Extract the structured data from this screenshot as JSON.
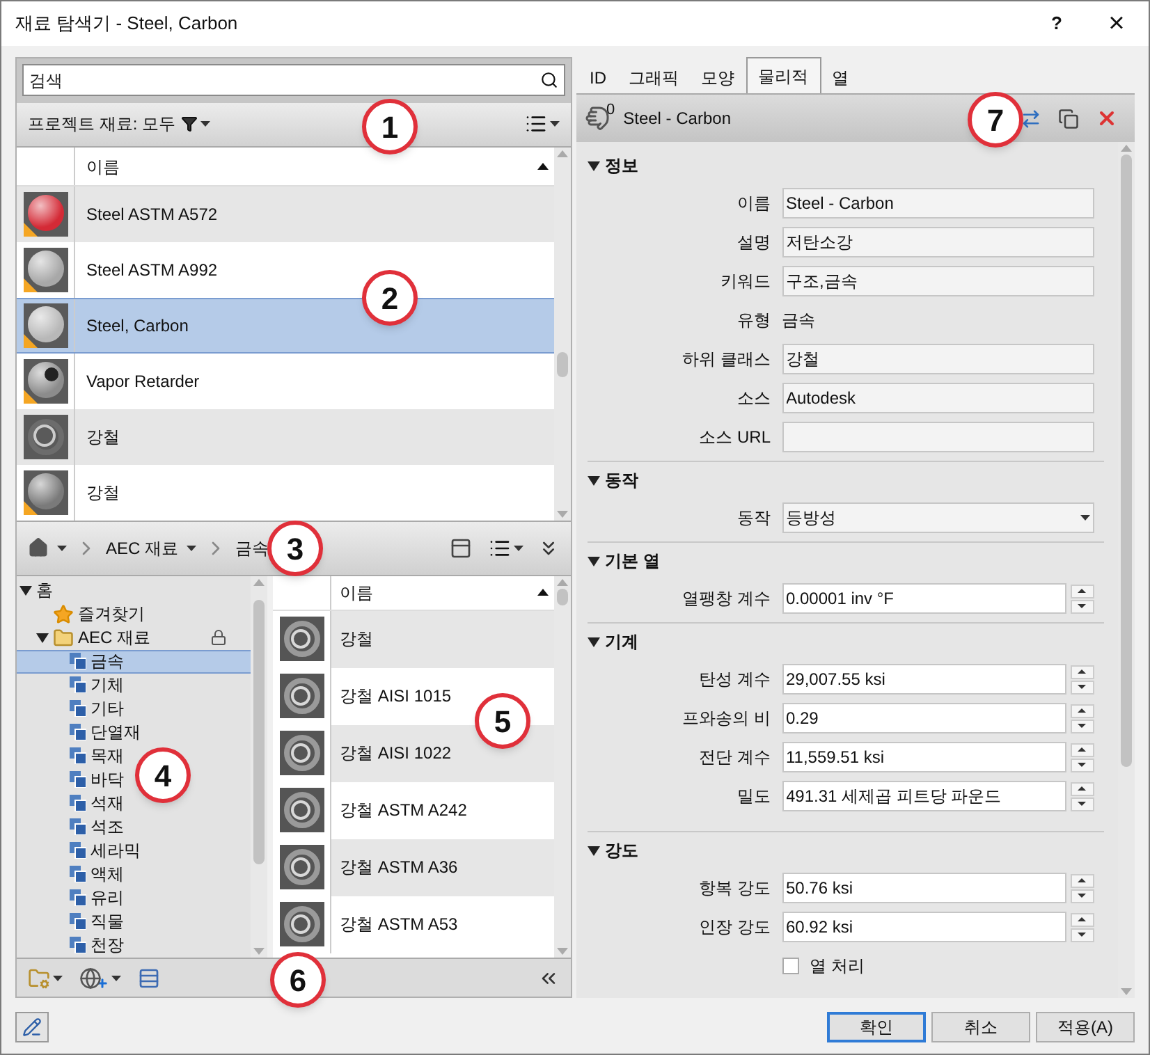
{
  "window": {
    "title": "재료 탐색기 - Steel, Carbon",
    "help": "?",
    "close": "×"
  },
  "project_panel": {
    "search": {
      "placeholder": "검색"
    },
    "filter_label": "프로젝트 재료: 모두",
    "column_header": "이름",
    "rows": [
      {
        "name": "Steel ASTM A572",
        "kind": "sphere",
        "color": "#d42a36",
        "warning": true,
        "selected": false
      },
      {
        "name": "Steel ASTM A992",
        "kind": "sphere",
        "color": "#a8a8a8",
        "warning": true,
        "selected": false
      },
      {
        "name": "Steel, Carbon",
        "kind": "sphere",
        "color": "#b8b8b8",
        "warning": true,
        "selected": true
      },
      {
        "name": "Vapor Retarder",
        "kind": "perforated",
        "color": "#8c8c8c",
        "warning": true,
        "selected": false
      },
      {
        "name": "강철",
        "kind": "ring",
        "color": "#6c6c6c",
        "warning": false,
        "selected": false
      },
      {
        "name": "강철",
        "kind": "sphere",
        "color": "#7a7a7a",
        "warning": true,
        "selected": false
      }
    ]
  },
  "library": {
    "breadcrumb": [
      {
        "label": "AEC 재료"
      },
      {
        "label": "금속"
      }
    ],
    "tree": [
      {
        "label": "홈",
        "expanded": true,
        "selected": false,
        "children": [
          {
            "label": "즐겨찾기",
            "kind": "favorites",
            "selected": false
          },
          {
            "label": "AEC 재료",
            "kind": "folder",
            "expanded": true,
            "locked": true,
            "selected": false,
            "children": [
              {
                "label": "금속",
                "kind": "category",
                "selected": true
              },
              {
                "label": "기체",
                "kind": "category",
                "selected": false
              },
              {
                "label": "기타",
                "kind": "category",
                "selected": false
              },
              {
                "label": "단열재",
                "kind": "category",
                "selected": false
              },
              {
                "label": "목재",
                "kind": "category",
                "selected": false
              },
              {
                "label": "바닥",
                "kind": "category",
                "selected": false
              },
              {
                "label": "석재",
                "kind": "category",
                "selected": false
              },
              {
                "label": "석조",
                "kind": "category",
                "selected": false
              },
              {
                "label": "세라믹",
                "kind": "category",
                "selected": false
              },
              {
                "label": "액체",
                "kind": "category",
                "selected": false
              },
              {
                "label": "유리",
                "kind": "category",
                "selected": false
              },
              {
                "label": "직물",
                "kind": "category",
                "selected": false
              },
              {
                "label": "천장",
                "kind": "category",
                "selected": false
              }
            ]
          }
        ]
      }
    ],
    "column_header": "이름",
    "items": [
      {
        "name": "강철"
      },
      {
        "name": "강철 AISI 1015"
      },
      {
        "name": "강철 AISI 1022"
      },
      {
        "name": "강철 ASTM A242"
      },
      {
        "name": "강철 ASTM A36"
      },
      {
        "name": "강철 ASTM A53"
      }
    ]
  },
  "properties": {
    "tabs": [
      {
        "label": "ID",
        "selected": false
      },
      {
        "label": "그래픽",
        "selected": false
      },
      {
        "label": "모양",
        "selected": false
      },
      {
        "label": "물리적",
        "selected": true
      },
      {
        "label": "열",
        "selected": false
      }
    ],
    "header": {
      "count": "0",
      "name": "Steel - Carbon"
    },
    "sections": [
      {
        "title": "정보",
        "expanded": true,
        "fields": [
          {
            "label": "이름",
            "value": "Steel - Carbon",
            "kind": "text"
          },
          {
            "label": "설명",
            "value": "저탄소강",
            "kind": "text"
          },
          {
            "label": "키워드",
            "value": "구조,금속",
            "kind": "text"
          },
          {
            "label": "유형",
            "value": "금속",
            "kind": "static"
          },
          {
            "label": "하위 클래스",
            "value": "강철",
            "kind": "text"
          },
          {
            "label": "소스",
            "value": "Autodesk",
            "kind": "text"
          },
          {
            "label": "소스 URL",
            "kind": "text"
          }
        ]
      },
      {
        "title": "동작",
        "expanded": true,
        "fields": [
          {
            "label": "동작",
            "value": "등방성",
            "kind": "dropdown"
          }
        ]
      },
      {
        "title": "기본 열",
        "expanded": true,
        "fields": [
          {
            "label": "열팽창 계수",
            "value": "0.00001 inv °F",
            "kind": "spinner"
          }
        ]
      },
      {
        "title": "기계",
        "expanded": true,
        "fields": [
          {
            "label": "탄성 계수",
            "value": "29,007.55 ksi",
            "kind": "spinner"
          },
          {
            "label": "프와송의 비",
            "value": "0.29",
            "kind": "spinner"
          },
          {
            "label": "전단 계수",
            "value": "11,559.51 ksi",
            "kind": "spinner"
          },
          {
            "label": "밀도",
            "value": "491.31 세제곱 피트당 파운드",
            "kind": "spinner"
          }
        ]
      },
      {
        "title": "강도",
        "expanded": true,
        "fields": [
          {
            "label": "항복 강도",
            "value": "50.76 ksi",
            "kind": "spinner"
          },
          {
            "label": "인장 강도",
            "value": "60.92 ksi",
            "kind": "spinner"
          },
          {
            "label": "열 처리",
            "kind": "checkbox",
            "checked": false
          }
        ]
      }
    ]
  },
  "buttons": [
    {
      "label": "확인",
      "default": true
    },
    {
      "label": "취소",
      "default": false
    },
    {
      "label": "적용(A)",
      "default": false
    }
  ],
  "callouts": [
    "1",
    "2",
    "3",
    "4",
    "5",
    "6",
    "7"
  ]
}
